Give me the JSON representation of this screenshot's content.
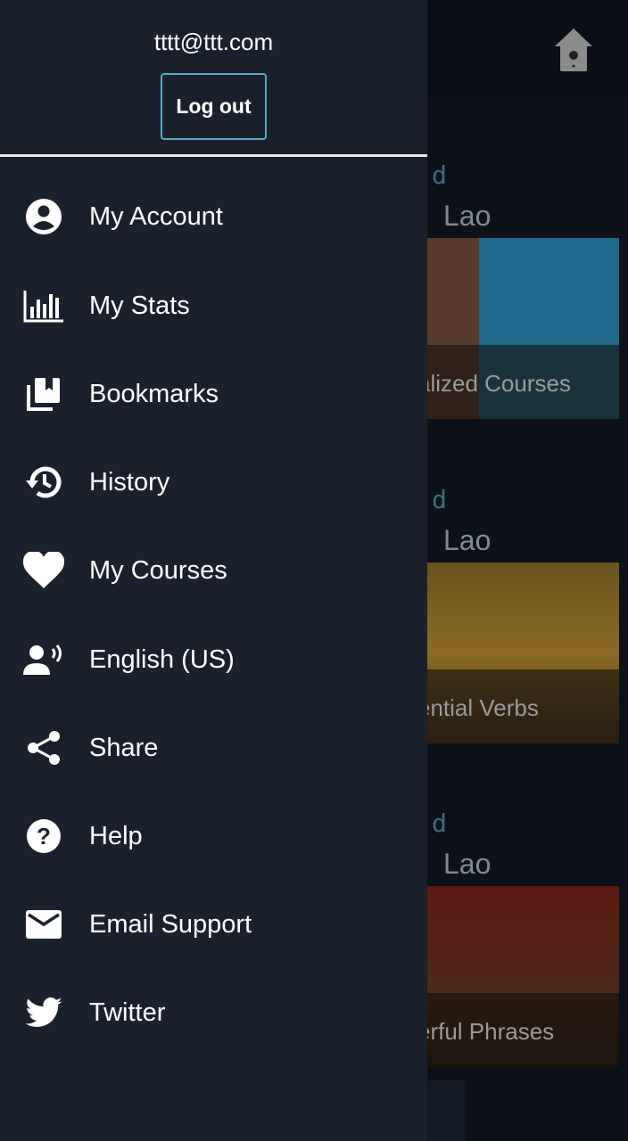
{
  "drawer": {
    "email": "tttt@ttt.com",
    "logout_label": "Log out",
    "items": [
      {
        "label": "My Account",
        "icon": "account-circle-icon"
      },
      {
        "label": "My Stats",
        "icon": "bar-chart-icon"
      },
      {
        "label": "Bookmarks",
        "icon": "bookmarks-icon"
      },
      {
        "label": "History",
        "icon": "history-icon"
      },
      {
        "label": "My Courses",
        "icon": "heart-icon"
      },
      {
        "label": "English (US)",
        "icon": "voice-icon"
      },
      {
        "label": "Share",
        "icon": "share-icon"
      },
      {
        "label": "Help",
        "icon": "help-icon"
      },
      {
        "label": "Email Support",
        "icon": "email-icon"
      },
      {
        "label": "Twitter",
        "icon": "twitter-icon"
      }
    ]
  },
  "background": {
    "header_icon": "home-icon",
    "cards": [
      {
        "tag": "d",
        "language": "Lao",
        "caption": "alized Courses"
      },
      {
        "tag": "d",
        "language": "Lao",
        "caption": "ential Verbs"
      },
      {
        "tag": "d",
        "language": "Lao",
        "caption": "erful Phrases"
      }
    ]
  },
  "colors": {
    "drawer_bg": "#1b212c",
    "accent": "#5aa6c8"
  }
}
